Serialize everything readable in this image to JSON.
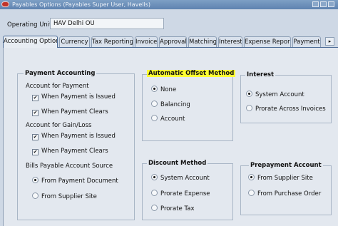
{
  "window": {
    "title": "Payables Options (Payables Super User, Havells)"
  },
  "operating_unit": {
    "label": "Operating Unit",
    "value": "HAV Delhi OU"
  },
  "tabs": [
    {
      "label": "Accounting Option",
      "active": true
    },
    {
      "label": "Currency"
    },
    {
      "label": "Tax Reporting"
    },
    {
      "label": "Invoice"
    },
    {
      "label": "Approval"
    },
    {
      "label": "Matching"
    },
    {
      "label": "Interest"
    },
    {
      "label": "Expense Report"
    },
    {
      "label": "Payment"
    }
  ],
  "tab_scroll_icon": "arrow-right-icon",
  "payment_accounting": {
    "title": "Payment Accounting",
    "account_for_payment_label": "Account for Payment",
    "when_payment_issued": {
      "label": "When Payment is Issued",
      "checked": true
    },
    "when_payment_clears": {
      "label": "When Payment Clears",
      "checked": true
    },
    "account_for_gain_loss_label": "Account for Gain/Loss",
    "gain_when_payment_issued": {
      "label": "When Payment is Issued",
      "checked": true
    },
    "gain_when_payment_clears": {
      "label": "When Payment Clears",
      "checked": true
    },
    "bills_payable_label": "Bills Payable Account Source",
    "from_payment_document": {
      "label": "From Payment Document",
      "selected": true
    },
    "from_supplier_site": {
      "label": "From Supplier Site",
      "selected": false
    }
  },
  "automatic_offset": {
    "title": "Automatic Offset Method",
    "highlight_color": "#ffff33",
    "options": [
      {
        "label": "None",
        "selected": true
      },
      {
        "label": "Balancing",
        "selected": false
      },
      {
        "label": "Account",
        "selected": false
      }
    ]
  },
  "interest": {
    "title": "Interest",
    "options": [
      {
        "label": "System Account",
        "selected": true
      },
      {
        "label": "Prorate Across Invoices",
        "selected": false
      }
    ]
  },
  "discount_method": {
    "title": "Discount Method",
    "options": [
      {
        "label": "System Account",
        "selected": true
      },
      {
        "label": "Prorate Expense",
        "selected": false
      },
      {
        "label": "Prorate Tax",
        "selected": false
      }
    ]
  },
  "prepayment_account": {
    "title": "Prepayment Account",
    "options": [
      {
        "label": "From Supplier Site",
        "selected": true
      },
      {
        "label": "From Purchase Order",
        "selected": false
      }
    ]
  }
}
